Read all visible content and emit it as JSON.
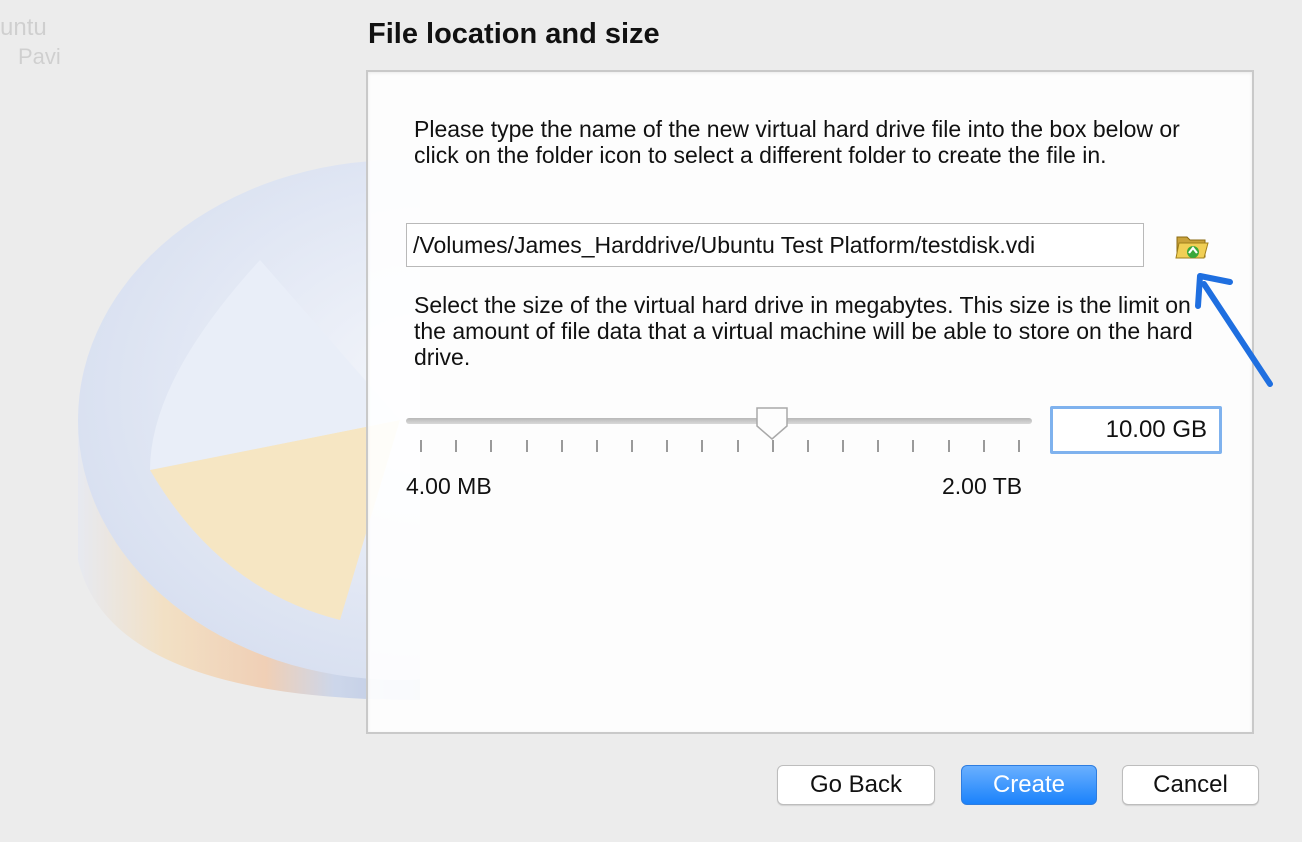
{
  "dialog": {
    "title": "File location and size"
  },
  "file_location": {
    "instructions": "Please type the name of the new virtual hard drive file into the box below or click on the folder icon to select a different folder to create the file in.",
    "path_value": "/Volumes/James_Harddrive/Ubuntu Test Platform/testdisk.vdi",
    "folder_icon": "folder-open-icon"
  },
  "file_size": {
    "instructions": "Select the size of the virtual hard drive in megabytes. This size is the limit on the amount of file data that a virtual machine will be able to store on the hard drive.",
    "value": "10.00 GB",
    "slider_fraction": 0.585,
    "tick_count": 18,
    "min_label": "4.00 MB",
    "max_label": "2.00 TB"
  },
  "buttons": {
    "back": "Go Back",
    "create": "Create",
    "cancel": "Cancel"
  },
  "colors": {
    "primary_button": "#1a82fb",
    "focus_ring": "#7fb2ee",
    "annotation_arrow": "#1f6fe0"
  }
}
